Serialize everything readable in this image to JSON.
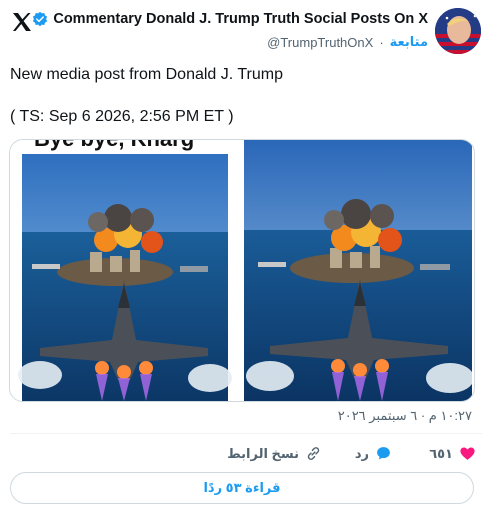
{
  "header": {
    "display_name": "Commentary Donald J. Trump Truth Social Posts On X",
    "handle": "@TrumpTruthOnX",
    "separator": "·",
    "follow_label": "متابعة"
  },
  "post": {
    "line1": "New media post from Donald J. Trump",
    "line2": "( TS: Sep 6 2026, 2:56 PM ET )"
  },
  "media": {
    "overlay_text": "Bye bye, Kharg"
  },
  "meta": {
    "timestamp": "١٠:٢٧ م · ٦ سبتمبر ٢٠٢٦"
  },
  "actions": {
    "like_count": "٦٥١",
    "reply_label": "رد",
    "copy_link_label": "نسخ الرابط"
  },
  "read_replies_label": "قراءة ٥٣ ردًا",
  "colors": {
    "accent": "#1d9bf0",
    "like": "#f91880",
    "text": "#0f1419",
    "muted": "#536471",
    "border": "#cfd9de"
  },
  "icons": [
    "x-logo-icon",
    "verified-badge-icon",
    "heart-icon",
    "reply-bubble-icon",
    "link-icon"
  ]
}
